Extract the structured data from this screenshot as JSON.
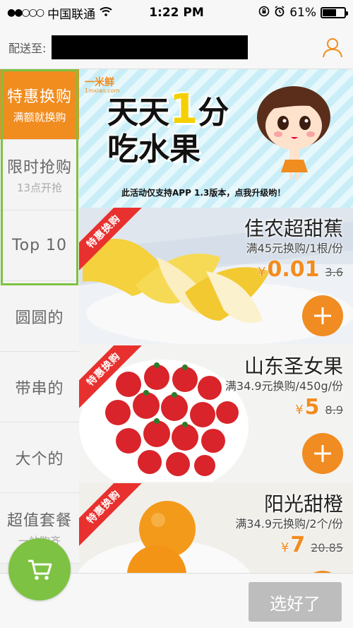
{
  "status_bar": {
    "carrier": "中国联通",
    "time": "1:22 PM",
    "battery": "61%"
  },
  "header": {
    "deliver_label": "配送至:"
  },
  "sidebar": {
    "items": [
      {
        "title": "特惠换购",
        "sub": "满额就换购",
        "active": true
      },
      {
        "title": "限时抢购",
        "sub": "13点开抢"
      },
      {
        "title": "Top 10",
        "sub": ""
      },
      {
        "title": "圆圆的",
        "sub": ""
      },
      {
        "title": "带串的",
        "sub": ""
      },
      {
        "title": "大个的",
        "sub": ""
      },
      {
        "title": "超值套餐",
        "sub": "一站购齐"
      }
    ]
  },
  "banner": {
    "brand": "一米鲜",
    "brand_url": "1mxian.com",
    "line1_a": "天天",
    "line1_b": "1",
    "line1_c": "分",
    "line2": "吃水果",
    "note": "此活动仅支持APP 1.3版本，点我升级哟！"
  },
  "products": [
    {
      "ribbon": "特惠换购",
      "name": "佳农超甜蕉",
      "desc": "满45元换购/1根/份",
      "currency": "¥",
      "price": "0.01",
      "old_price": "3.6"
    },
    {
      "ribbon": "特惠换购",
      "name": "山东圣女果",
      "desc": "满34.9元换购/450g/份",
      "currency": "¥",
      "price": "5",
      "old_price": "8.9"
    },
    {
      "ribbon": "特惠换购",
      "name": "阳光甜橙",
      "desc": "满34.9元换购/2个/份",
      "currency": "¥",
      "price": "7",
      "old_price": "20.85"
    }
  ],
  "bottom": {
    "done_label": "选好了"
  },
  "colors": {
    "accent": "#f18c1f",
    "green": "#7dc242",
    "ribbon": "#e8312f"
  }
}
